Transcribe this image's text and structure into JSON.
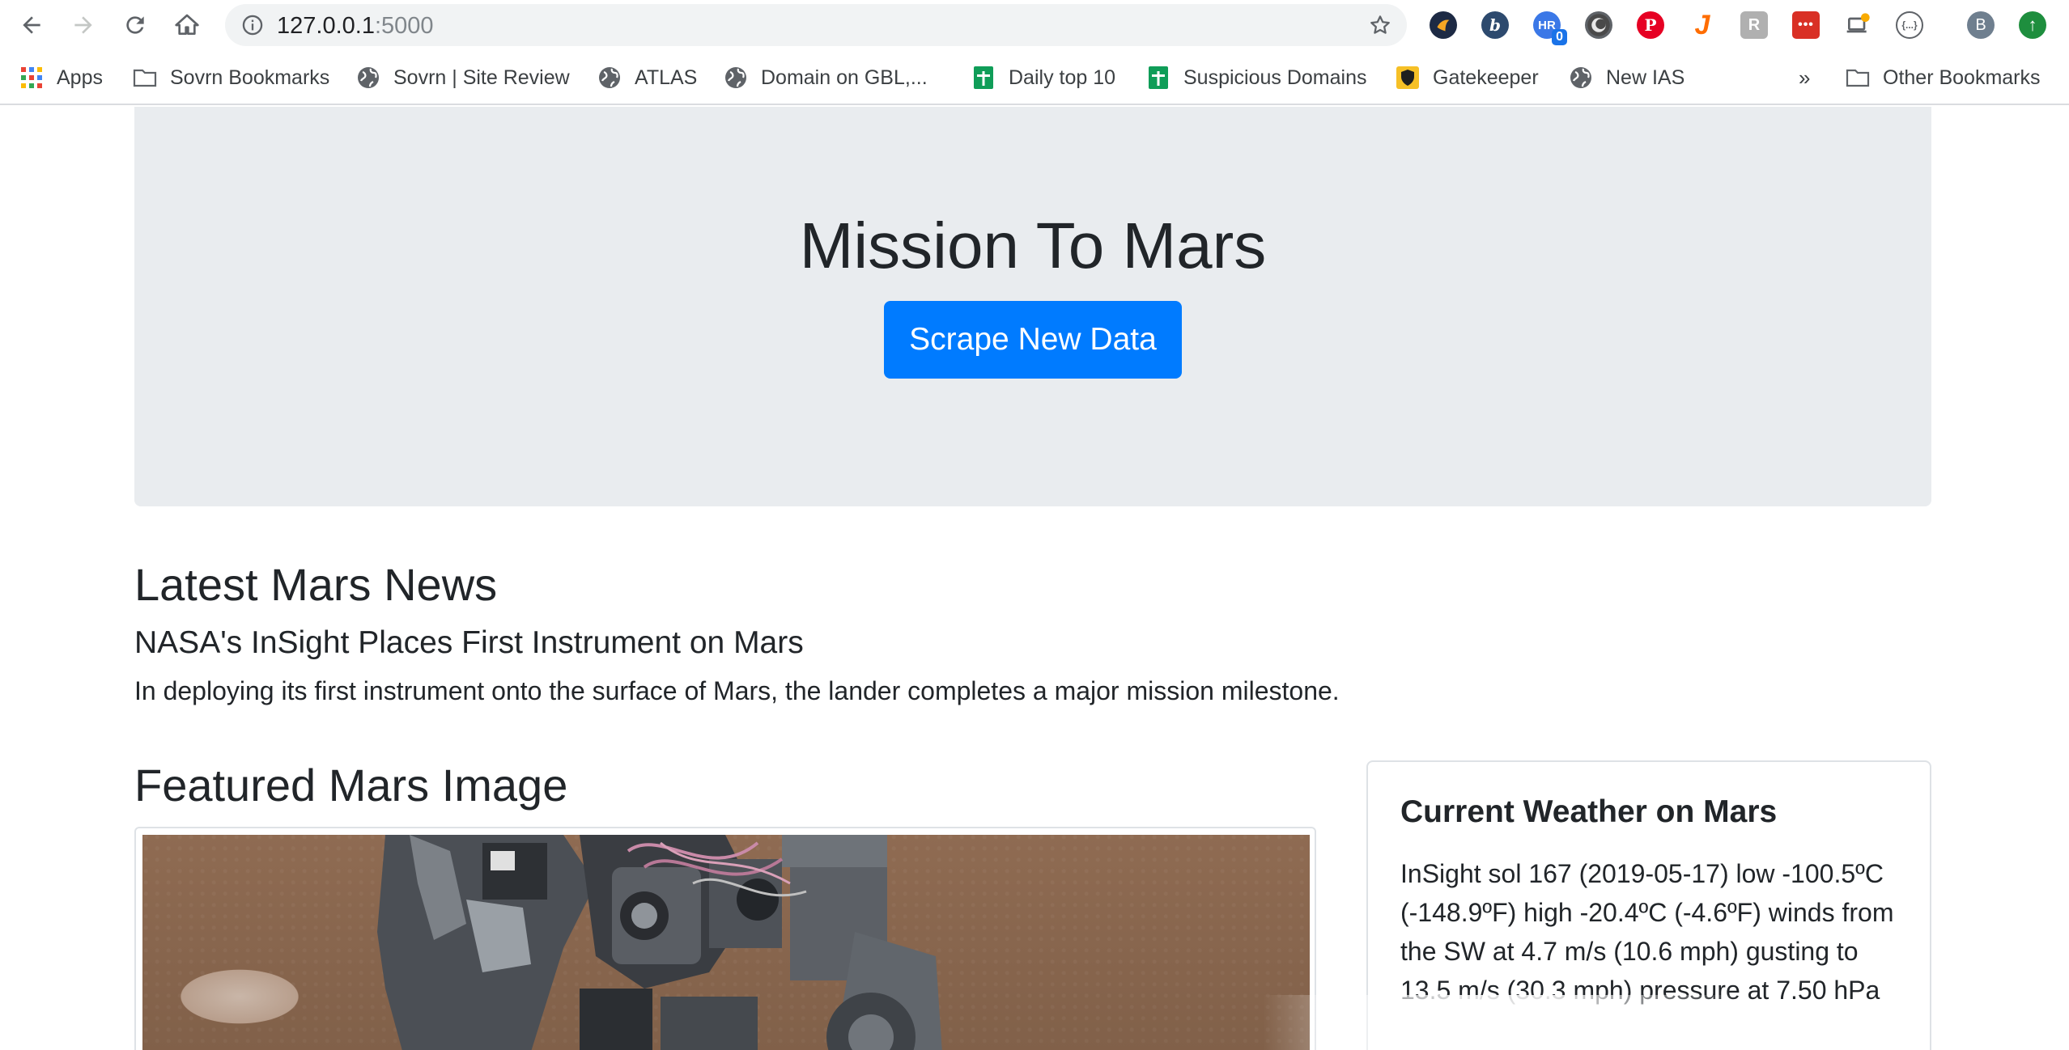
{
  "browser": {
    "url_host": "127.0.0.1",
    "url_port": ":5000",
    "extensions": [
      {
        "name": "sovrn-extension",
        "color": "#1d2a44"
      },
      {
        "name": "b-extension",
        "color": "#2d4a6e",
        "glyph": "b"
      },
      {
        "name": "hr-extension",
        "color": "#3b78e7",
        "glyph": "HR",
        "badge": "0"
      },
      {
        "name": "circle-extension",
        "color": "#5f6368"
      },
      {
        "name": "pinterest-extension",
        "color": "#e60023",
        "glyph": "P"
      },
      {
        "name": "j-extension",
        "color": "#ff6d00",
        "glyph": "J"
      },
      {
        "name": "r-extension",
        "color": "#b0b0b0",
        "glyph": "R"
      },
      {
        "name": "dots-extension",
        "color": "#d93025",
        "glyph": "..."
      },
      {
        "name": "laptop-extension",
        "color": "#f9ab00"
      },
      {
        "name": "brackets-extension",
        "color": "#5f6368",
        "glyph": "{...}"
      },
      {
        "name": "profile-avatar",
        "color": "#6f7f8f",
        "glyph": "B"
      },
      {
        "name": "update-extension",
        "color": "#1e8e3e",
        "glyph": "↑"
      }
    ]
  },
  "bookmarks": [
    {
      "label": "Apps",
      "icon": "apps-grid-icon"
    },
    {
      "label": "Sovrn Bookmarks",
      "icon": "folder-icon"
    },
    {
      "label": "Sovrn | Site Review",
      "icon": "globe-icon"
    },
    {
      "label": "ATLAS",
      "icon": "globe-icon"
    },
    {
      "label": "Domain on GBL,...",
      "icon": "globe-icon"
    },
    {
      "label": "Daily top 10",
      "icon": "sheets-icon"
    },
    {
      "label": "Suspicious Domains",
      "icon": "sheets-icon"
    },
    {
      "label": "Gatekeeper",
      "icon": "shield-icon"
    },
    {
      "label": "New IAS",
      "icon": "globe-icon"
    }
  ],
  "bookmarks_overflow": "»",
  "other_bookmarks": "Other Bookmarks",
  "page": {
    "title": "Mission To Mars",
    "scrape_button": "Scrape New Data",
    "news_heading": "Latest Mars News",
    "news_title": "NASA's InSight Places First Instrument on Mars",
    "news_paragraph": "In deploying its first instrument onto the surface of Mars, the lander completes a major mission milestone.",
    "featured_heading": "Featured Mars Image",
    "weather_title": "Current Weather on Mars",
    "weather_text": "InSight sol 167 (2019-05-17) low -100.5ºC (-148.9ºF) high -20.4ºC (-4.6ºF) winds from the SW at 4.7 m/s (10.6 mph) gusting to 13.5 m/s (30.3 mph) pressure at 7.50 hPa"
  }
}
